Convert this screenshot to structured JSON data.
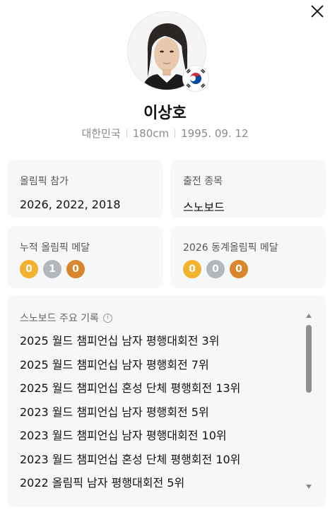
{
  "profile": {
    "name": "이상호",
    "country": "대한민국",
    "height": "180cm",
    "birthdate": "1995. 09. 12",
    "flag_icon": "korea-flag-icon"
  },
  "cards": {
    "olympics": {
      "label": "올림픽 참가",
      "value": "2026, 2022, 2018"
    },
    "event": {
      "label": "출전 종목",
      "value": "스노보드"
    },
    "total_medals": {
      "label": "누적 올림픽 메달",
      "gold": "0",
      "silver": "1",
      "bronze": "0"
    },
    "winter_2026_medals": {
      "label": "2026 동계올림픽 메달",
      "gold": "0",
      "silver": "0",
      "bronze": "0"
    }
  },
  "records": {
    "title": "스노보드 주요 기록",
    "items": [
      "2025 월드 챔피언십 남자 평행대회전 3위",
      "2025 월드 챔피언십 남자 평행회전 7위",
      "2025 월드 챔피언십 혼성 단체 평행회전 13위",
      "2023 월드 챔피언십 남자 평행회전 5위",
      "2023 월드 챔피언십 남자 평행대회전 10위",
      "2023 월드 챔피언십 혼성 단체 평행회전 10위",
      "2022 올림픽 남자 평행대회전 5위"
    ]
  },
  "colors": {
    "gold": "#f2b12e",
    "silver": "#b3b7bd",
    "bronze": "#d9862c",
    "card_bg": "#f6f7f9"
  }
}
